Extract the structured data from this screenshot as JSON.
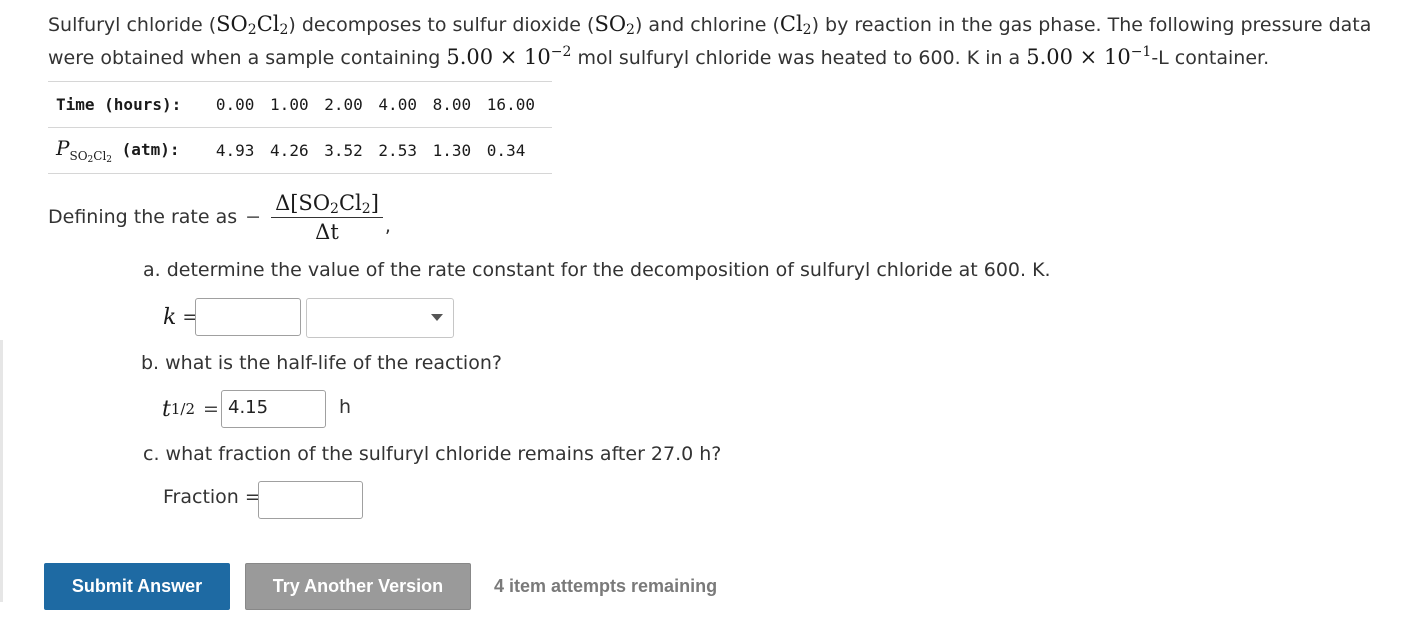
{
  "intro": {
    "p1": "Sulfuryl chloride (",
    "so2cl2_a": "SO",
    "so2cl2_b": "2",
    "so2cl2_c": "Cl",
    "so2cl2_d": "2",
    "p2": ") decomposes to sulfur dioxide (",
    "so2_a": "SO",
    "so2_b": "2",
    "p3": ") and chlorine (",
    "cl2_a": "Cl",
    "cl2_b": "2",
    "p4": ") by reaction in the gas phase. The following pressure data were obtained when a sample containing ",
    "moles_mant": "5.00 × 10",
    "moles_exp": "−2",
    "p5": " mol sulfuryl chloride was heated to 600. K in a ",
    "vol_mant": "5.00 × 10",
    "vol_exp": "−1",
    "p6": "-L container."
  },
  "table": {
    "time_header": "Time (hours):",
    "pressure_symbol": "P",
    "pressure_sub_a": "SO",
    "pressure_sub_b": "2",
    "pressure_sub_c": "Cl",
    "pressure_sub_d": "2",
    "pressure_unit": "(atm):",
    "time_values": [
      "0.00",
      "1.00",
      "2.00",
      "4.00",
      "8.00",
      "16.00"
    ],
    "pressure_values": [
      "4.93",
      "4.26",
      "3.52",
      "2.53",
      "1.30",
      "0.34"
    ]
  },
  "rate": {
    "text": "Defining the rate as",
    "minus": "−",
    "num_a": "Δ[SO",
    "num_b": "2",
    "num_c": "Cl",
    "num_d": "2",
    "num_e": "]",
    "den": "Δt",
    "comma": ","
  },
  "part_a": {
    "question": "a. determine the value of the rate constant for the decomposition of sulfuryl chloride at 600. K.",
    "k_symbol": "k",
    "equals": "=",
    "k_value": "",
    "unit_selected": ""
  },
  "part_b": {
    "question": "b. what is the half-life of the reaction?",
    "t_symbol": "t",
    "t_sub": "1/2",
    "equals": "=",
    "value": "4.15",
    "unit": "h"
  },
  "part_c": {
    "question": "c. what fraction of the sulfuryl chloride remains after 27.0 h?",
    "label": "Fraction =",
    "value": ""
  },
  "actions": {
    "submit_label": "Submit Answer",
    "try_another_label": "Try Another Version",
    "attempts_text": "4 item attempts remaining"
  },
  "colors": {
    "submit_bg": "#1e6aa3",
    "try_another_bg": "#9a9a9a",
    "attempts_text": "#7a7a7a"
  }
}
